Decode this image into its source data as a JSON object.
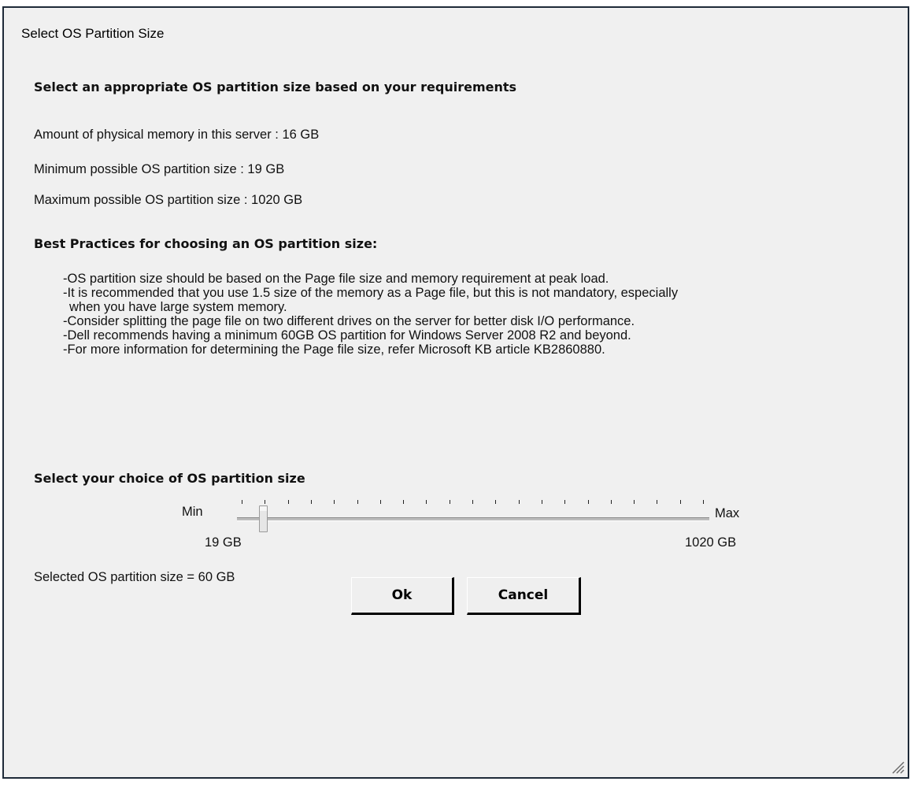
{
  "dialog": {
    "title": "Select OS Partition Size",
    "heading": "Select an appropriate OS partition size based on your requirements",
    "memory_text": "Amount of physical memory in this server : 16 GB",
    "min_text": "Minimum possible OS partition size  : 19 GB",
    "max_text": "Maximum possible OS partition size  : 1020 GB",
    "best_practices_heading": "Best Practices for choosing an OS partition size:",
    "best_practices": [
      "-OS partition size should be based on the Page file size and memory requirement at peak load.",
      "-It is recommended that you use 1.5 size of the memory as a Page file, but this is not mandatory, especially",
      "  when you have large system memory.",
      "-Consider splitting the page file on two different drives on the server for better disk I/O performance.",
      "-Dell recommends having a minimum 60GB OS partition for Windows Server 2008 R2 and beyond.",
      "-For more information for determining the Page file size, refer Microsoft KB article KB2860880."
    ],
    "choice_heading": "Select your choice of OS partition size"
  },
  "slider": {
    "min_label": "Min",
    "max_label": "Max",
    "min_value_label": "19  GB",
    "max_value_label": "1020 GB",
    "min_value": 19,
    "max_value": 1020,
    "value": 60,
    "tick_count": 21
  },
  "selected_text": "Selected OS partition size = 60 GB",
  "buttons": {
    "ok": "Ok",
    "cancel": "Cancel"
  }
}
